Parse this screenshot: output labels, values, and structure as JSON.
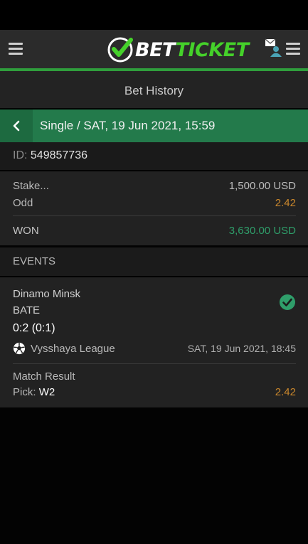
{
  "brand": {
    "name_part1": "BET",
    "name_part2": "TICKET",
    "accent_color": "#45d12a"
  },
  "page": {
    "title": "Bet History"
  },
  "bet": {
    "header": "Single / SAT,  19  Jun  2021,  15:59",
    "id_label": "ID:",
    "id_value": "549857736",
    "stake_label": "Stake...",
    "stake_value": "1,500.00 USD",
    "odd_label": "Odd",
    "odd_value": "2.42",
    "result_label": "WON",
    "result_value": "3,630.00 USD"
  },
  "events": {
    "header": "EVENTS",
    "items": [
      {
        "home": "Dinamo  Minsk",
        "away": "BATE",
        "score": "0:2 (0:1)",
        "league": "Vysshaya  League",
        "datetime": "SAT,  19  Jun  2021,  18:45",
        "market": "Match  Result",
        "pick_label": "Pick:",
        "pick_value": "W2",
        "odd": "2.42",
        "status_icon": "check-circle-icon"
      }
    ]
  },
  "colors": {
    "odd": "#c8862c",
    "won": "#2f9e6a",
    "header_green": "#237a4b"
  }
}
